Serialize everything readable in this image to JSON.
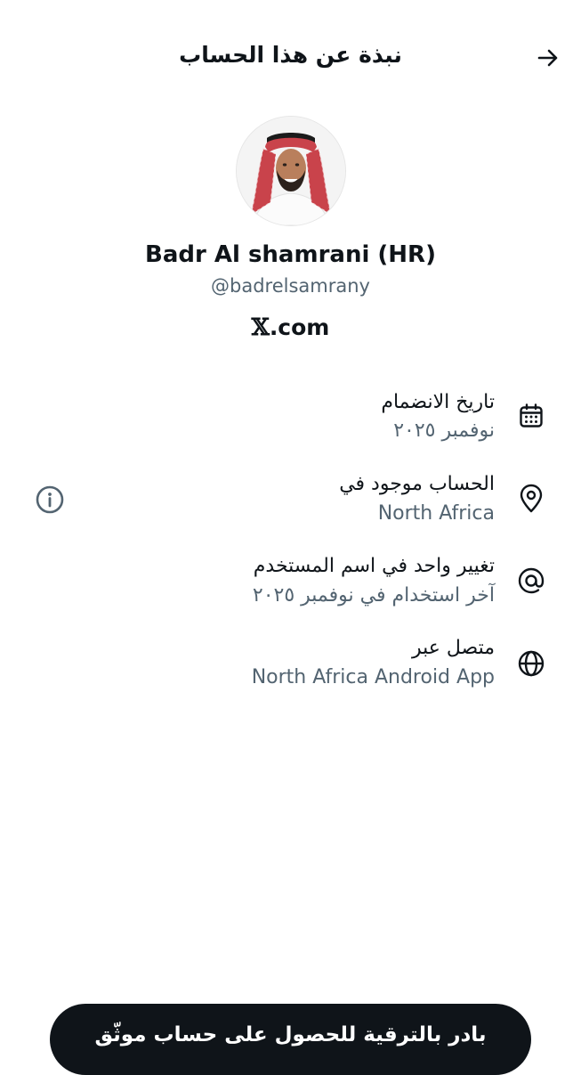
{
  "header": {
    "title": "نبذة عن هذا الحساب",
    "back_icon": "arrow-right-icon"
  },
  "profile": {
    "display_name": "Badr Al shamrani (HR)",
    "handle": "@badrelsamrany",
    "badge_text": ".com",
    "badge_glyph": "𝕏"
  },
  "rows": [
    {
      "icon": "calendar-icon",
      "title": "تاريخ الانضمام",
      "subtitle": "نوفمبر ٢٠٢٥"
    },
    {
      "icon": "location-pin-icon",
      "title": "الحساب موجود في",
      "subtitle": "North Africa"
    },
    {
      "icon": "at-sign-icon",
      "title": "تغيير واحد في اسم المستخدم",
      "subtitle": "آخر استخدام في نوفمبر ٢٠٢٥"
    },
    {
      "icon": "globe-icon",
      "title": "متصل عبر",
      "subtitle": "North Africa Android App"
    }
  ],
  "info_icon": "info-icon",
  "footer": {
    "upgrade_label": "بادر بالترقية للحصول على حساب موثّق"
  },
  "colors": {
    "text_primary": "#0f1419",
    "text_secondary": "#536471",
    "button_bg": "#0f1419",
    "button_text": "#ffffff"
  }
}
